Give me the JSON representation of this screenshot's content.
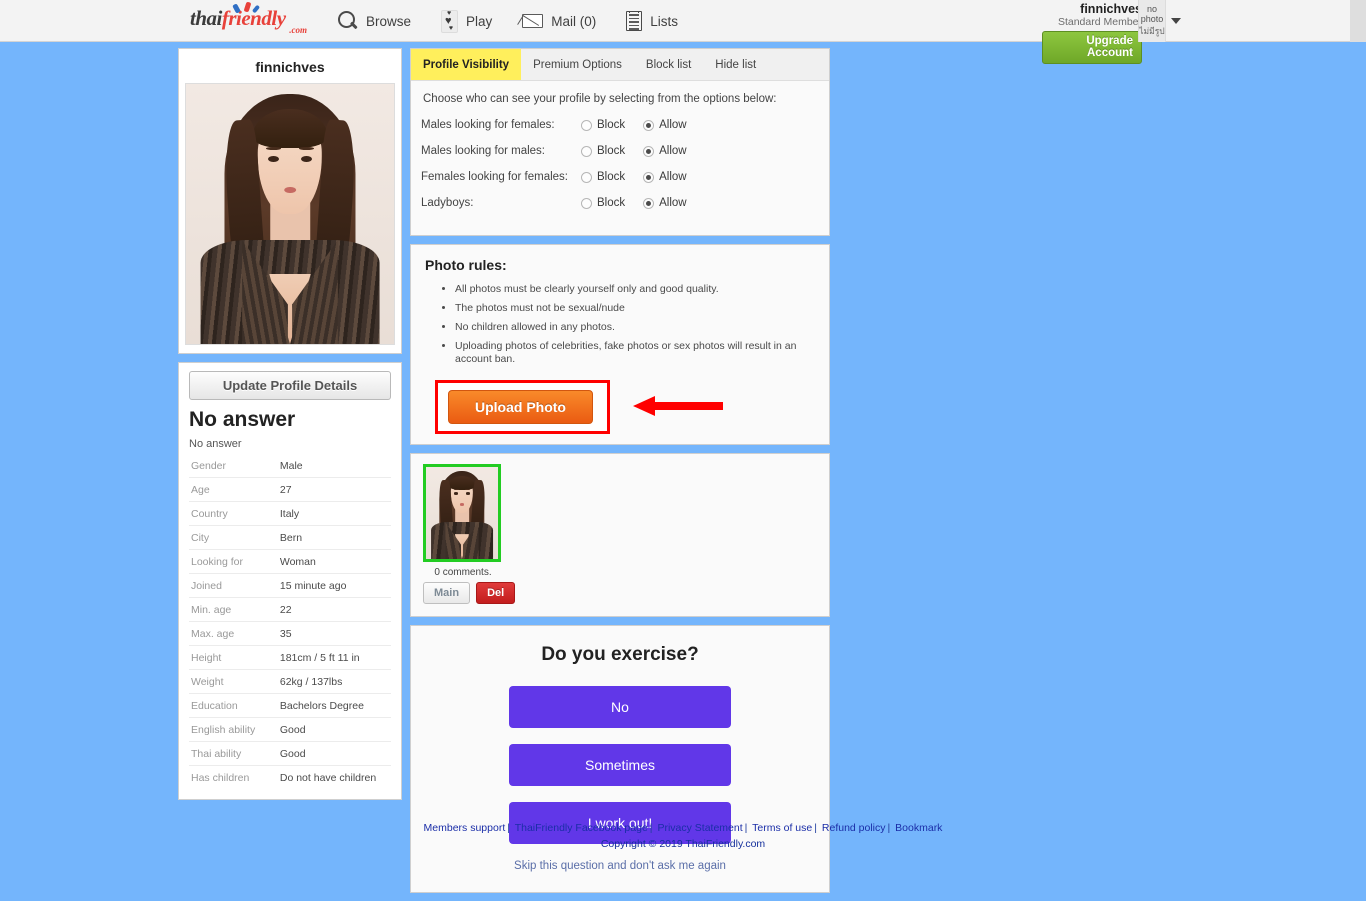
{
  "header": {
    "logo_thai": "thai",
    "logo_friendly": "friendly",
    "logo_com": ".com",
    "nav": [
      {
        "label": "Browse",
        "icon": "search-icon"
      },
      {
        "label": "Play",
        "icon": "playing-card-heart-icon"
      },
      {
        "label": "Mail (0)",
        "icon": "envelope-icon"
      },
      {
        "label": "Lists",
        "icon": "notepad-icon"
      }
    ],
    "user_name": "finnichves",
    "user_rank": "Standard Member",
    "upgrade_label": "Upgrade Account",
    "avatar_line1": "no",
    "avatar_line2": "photo",
    "avatar_thai": "ไม่มีรูป"
  },
  "profile_card": {
    "name": "finnichves"
  },
  "details": {
    "update_button": "Update Profile Details",
    "heading": "No answer",
    "subtext": "No answer",
    "rows": [
      {
        "key": "Gender",
        "value": "Male"
      },
      {
        "key": "Age",
        "value": "27"
      },
      {
        "key": "Country",
        "value": "Italy"
      },
      {
        "key": "City",
        "value": "Bern"
      },
      {
        "key": "Looking for",
        "value": "Woman"
      },
      {
        "key": "Joined",
        "value": "15 minute ago"
      },
      {
        "key": "Min. age",
        "value": "22"
      },
      {
        "key": "Max. age",
        "value": "35"
      },
      {
        "key": "Height",
        "value": "181cm / 5 ft 11 in"
      },
      {
        "key": "Weight",
        "value": "62kg / 137lbs"
      },
      {
        "key": "Education",
        "value": "Bachelors Degree"
      },
      {
        "key": "English ability",
        "value": "Good"
      },
      {
        "key": "Thai ability",
        "value": "Good"
      },
      {
        "key": "Has children",
        "value": "Do not have children"
      }
    ]
  },
  "tabs": [
    {
      "label": "Profile Visibility",
      "active": true
    },
    {
      "label": "Premium Options",
      "active": false
    },
    {
      "label": "Block list",
      "active": false
    },
    {
      "label": "Hide list",
      "active": false
    }
  ],
  "visibility": {
    "lead": "Choose who can see your profile by selecting from the options below:",
    "block_label": "Block",
    "allow_label": "Allow",
    "rows": [
      {
        "label": "Males looking for females:",
        "selected": "Allow"
      },
      {
        "label": "Males looking for males:",
        "selected": "Allow"
      },
      {
        "label": "Females looking for females:",
        "selected": "Allow"
      },
      {
        "label": "Ladyboys:",
        "selected": "Allow"
      }
    ]
  },
  "photo_rules": {
    "title": "Photo rules:",
    "items": [
      "All photos must be clearly yourself only and good quality.",
      "The photos must not be sexual/nude",
      "No children allowed in any photos.",
      "Uploading photos of celebrities, fake photos or sex photos will result in an account ban."
    ],
    "upload_label": "Upload Photo",
    "highlight_color": "#ff0000",
    "button_color": "#ea5b12"
  },
  "photos": {
    "comments_text": "0 comments.",
    "main_label": "Main",
    "del_label": "Del",
    "selected_border_color": "#22cc22"
  },
  "question": {
    "title": "Do you exercise?",
    "options": [
      "No",
      "Sometimes",
      "I work out!"
    ],
    "skip_label": "Skip this question and don't ask me again",
    "button_color": "#6137e8"
  },
  "footer": {
    "links": [
      "Members support",
      "ThaiFriendly Facebook page",
      "Privacy Statement",
      "Terms of use",
      "Refund policy",
      "Bookmark"
    ],
    "separator": "|",
    "copyright": "Copyright © 2019 ThaiFriendly.com"
  },
  "theme": {
    "page_background": "#74b5fc",
    "active_tab": "#ffef5c"
  }
}
